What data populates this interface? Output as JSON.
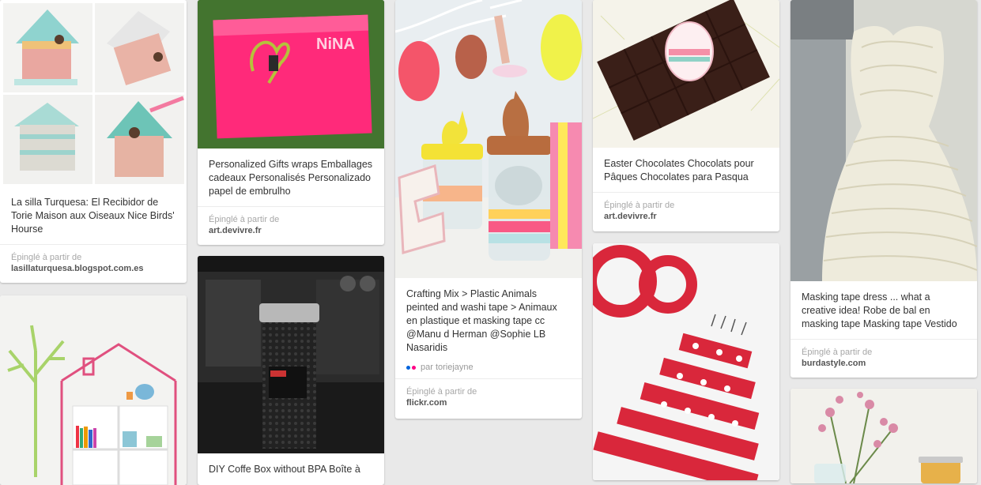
{
  "pins": [
    {
      "desc": "La silla Turquesa: El Recibidor de Torie Maison aux Oiseaux Nice Birds' Hourse",
      "pinned_label": "Épinglé à partir de",
      "source": "lasillaturquesa.blogspot.com.es"
    },
    {
      "desc": "Personalized Gifts wraps Emballages cadeaux Personalisés Personalizado papel de embrulho",
      "pinned_label": "Épinglé à partir de",
      "source": "art.devivre.fr",
      "image_text": "NiNA"
    },
    {
      "desc": "Crafting Mix > Plastic Animals peinted and washi tape > Animaux en plastique et masking tape cc @Manu d Herman @Sophie LB Nasaridis",
      "via": "par toriejayne",
      "pinned_label": "Épinglé à partir de",
      "source": "flickr.com"
    },
    {
      "desc": "Easter Chocolates Chocolats pour Pâques Chocolates para Pasqua",
      "pinned_label": "Épinglé à partir de",
      "source": "art.devivre.fr"
    },
    {
      "desc": "Masking tape dress ... what a creative idea! Robe de bal en masking tape Masking tape Vestido",
      "pinned_label": "Épinglé à partir de",
      "source": "burdastyle.com"
    },
    {
      "desc": "DIY Coffe Box without BPA Boîte à"
    }
  ],
  "colors": {
    "background": "#e9e9e9",
    "card": "#ffffff",
    "text": "#333333",
    "muted": "#a7a7a7",
    "flickr_blue": "#0063dc",
    "flickr_pink": "#ff0084"
  },
  "icons": {
    "flickr": "flickr-icon"
  }
}
